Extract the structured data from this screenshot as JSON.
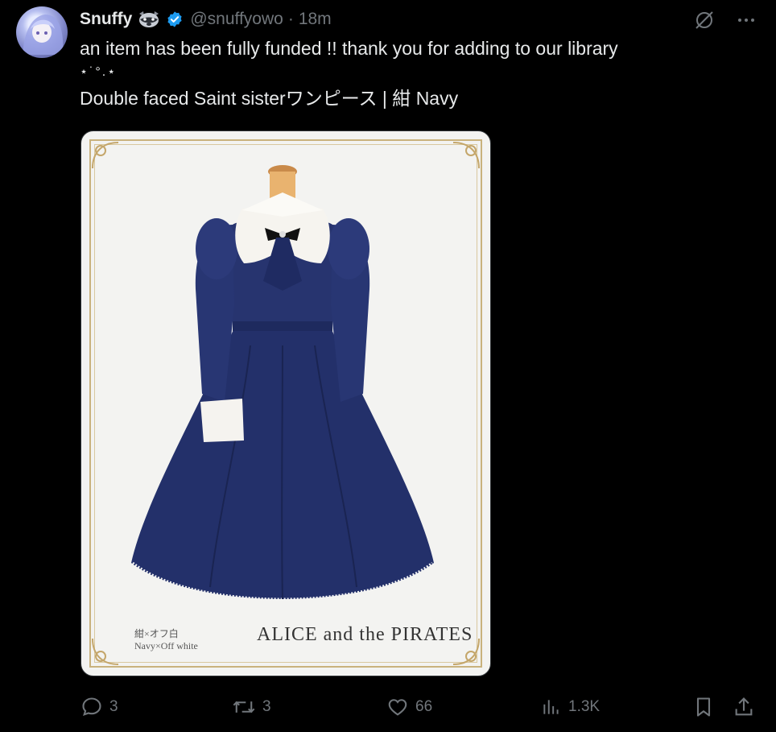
{
  "tweet": {
    "display_name": "Snuffy",
    "name_emoji": "raccoon-emoji",
    "verified_icon": "verified-badge-icon",
    "handle": "@snuffyowo",
    "separator": "·",
    "time": "18m",
    "text_line1": "an item has been fully funded !! thank you for adding to our library",
    "text_line2": "⋆˙°.⋆",
    "text_line3": "Double faced Saint sisterワンピース | 紺 Navy"
  },
  "media": {
    "caption_jp": "紺×オフ白",
    "caption_en": "Navy×Off white",
    "brand_text": "ALICE and the PIRATES"
  },
  "actions": {
    "replies": "3",
    "reposts": "3",
    "likes": "66",
    "views": "1.3K"
  },
  "colors": {
    "background": "#000000",
    "text": "#e7e9ea",
    "muted": "#71767b",
    "verified": "#1d9bf0",
    "dress": "#23306a"
  }
}
